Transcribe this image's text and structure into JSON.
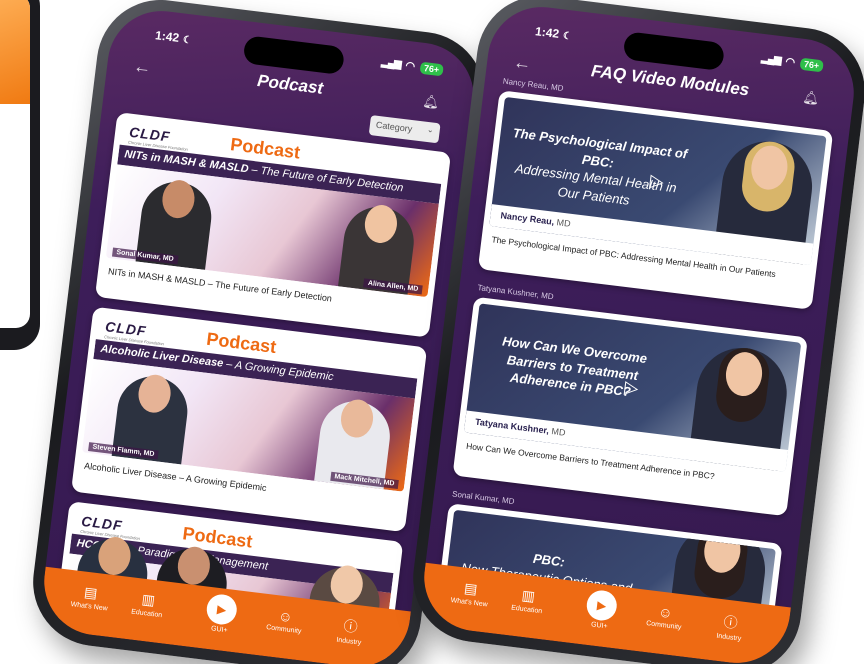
{
  "colors": {
    "accent": "#ee6a13",
    "screen_bg": "#3d1e5a",
    "card": "#ffffff"
  },
  "status": {
    "time": "1:42",
    "moon_icon": "moon-icon",
    "battery": "76+"
  },
  "podcast_screen": {
    "title": "Podcast",
    "category_label": "Category",
    "cards": [
      {
        "org": "CLDF",
        "label": "Podcast",
        "topic_bold": "NITs in MASH & MASLD",
        "topic_rest": " – The Future of Early Detection",
        "speaker_left": "Sonal Kumar, MD",
        "speaker_right": "Alina Allen, MD",
        "title": "NITs in MASH & MASLD – The Future of Early Detection"
      },
      {
        "org": "CLDF",
        "label": "Podcast",
        "topic_bold": "Alcoholic Liver Disease",
        "topic_rest": " – A Growing Epidemic",
        "speaker_left": "Steven Flamm, MD",
        "speaker_right": "Mack Mitchell, MD",
        "title": "Alcoholic Liver Disease – A Growing Epidemic"
      },
      {
        "org": "CLDF",
        "label": "Podcast",
        "topic_bold": "HCC",
        "topic_rest": " – New Paradigms in Management"
      }
    ]
  },
  "faq_screen": {
    "title": "FAQ Video Modules",
    "items": [
      {
        "presenter": "Nancy Reau, MD",
        "thumb_line1": "The Psychological Impact of PBC:",
        "thumb_line2": "Addressing Mental Health in Our Patients",
        "bar_name": "Nancy Reau,",
        "bar_deg": " MD",
        "title": "The Psychological Impact of PBC: Addressing Mental Health in Our Patients"
      },
      {
        "presenter": "Tatyana Kushner, MD",
        "thumb_line1": "How Can We Overcome Barriers to Treatment Adherence in PBC?",
        "thumb_line2": "",
        "bar_name": "Tatyana Kushner,",
        "bar_deg": " MD",
        "title": "How Can We Overcome Barriers to Treatment Adherence in PBC?"
      },
      {
        "presenter": "Sonal Kumar, MD",
        "thumb_line1": "PBC:",
        "thumb_line2": "New Therapeutic Options and"
      }
    ]
  },
  "tabbar": {
    "whats_new": "What's New",
    "education": "Education",
    "gui": "GUI+",
    "community": "Community",
    "industry": "Industry"
  }
}
